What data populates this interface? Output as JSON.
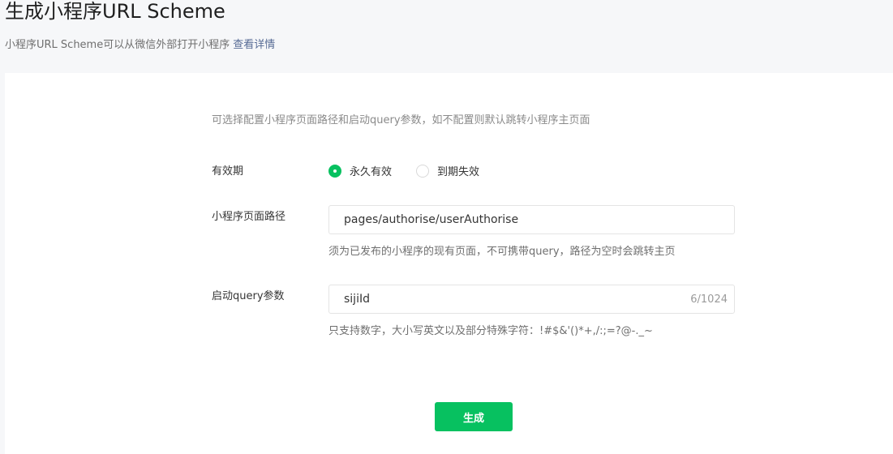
{
  "header": {
    "title": "生成小程序URL Scheme",
    "description": "小程序URL Scheme可以从微信外部打开小程序",
    "details_link": "查看详情"
  },
  "form": {
    "tip": "可选择配置小程序页面路径和启动query参数，如不配置则默认跳转小程序主页面",
    "validity": {
      "label": "有效期",
      "options": [
        {
          "label": "永久有效",
          "checked": true
        },
        {
          "label": "到期失效",
          "checked": false
        }
      ]
    },
    "page_path": {
      "label": "小程序页面路径",
      "value": "pages/authorise/userAuthorise",
      "hint": "须为已发布的小程序的现有页面，不可携带query，路径为空时会跳转主页"
    },
    "query": {
      "label": "启动query参数",
      "value": "sijiId",
      "counter": "6/1024",
      "hint": "只支持数字，大小写英文以及部分特殊字符：!#$&'()*+,/:;=?@-._~"
    },
    "submit_label": "生成"
  },
  "colors": {
    "accent": "#07c160",
    "link": "#576b95",
    "background": "#f6f7f9"
  }
}
